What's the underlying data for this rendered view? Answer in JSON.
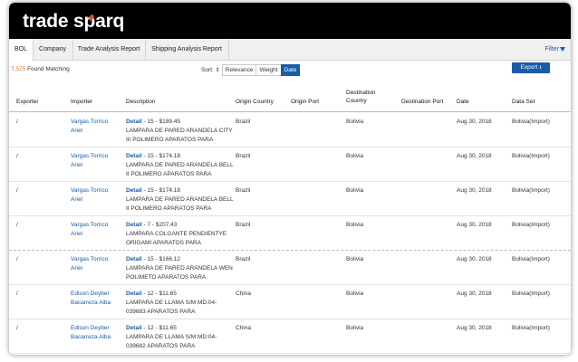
{
  "app": {
    "logo_text": "trade sparq"
  },
  "tabs": [
    {
      "label": "BOL"
    },
    {
      "label": "Company"
    },
    {
      "label": "Trade Analysis Report"
    },
    {
      "label": "Shipping Analysis Report"
    }
  ],
  "filter_label": "Filter",
  "results": {
    "count": "7,575",
    "suffix": " Found Matching"
  },
  "sort": {
    "label": "Sort:",
    "options": [
      "Relevance",
      "Weight",
      "Date"
    ],
    "selected": "Date"
  },
  "export_label": "Export",
  "columns": [
    "Exporter",
    "Importer",
    "Description",
    "Origin Country",
    "Origin Port",
    "Destination Country",
    "Destination Port",
    "Date",
    "Data Set"
  ],
  "rows": [
    {
      "exporter": "/",
      "importer": "Vargas Torrico Ariel",
      "detail": "Detail",
      "meta": " - 15 - $189.45",
      "desc": "LAMPARA DE PARED ARANDELA CITY III POLIMERO APARATOS PARA",
      "origin": "Brazil",
      "origin_port": "",
      "dest": "Bolivia",
      "dest_port": "",
      "date": "Aug 30, 2018",
      "dataset": "Bolivia(Import)"
    },
    {
      "exporter": "/",
      "importer": "Vargas Torrico Ariel",
      "detail": "Detail",
      "meta": " - 15 - $174.18",
      "desc": "LAMPARA DE PARED ARANDELA BELL II POLIMERO APARATOS PARA",
      "origin": "Brazil",
      "origin_port": "",
      "dest": "Bolivia",
      "dest_port": "",
      "date": "Aug 30, 2018",
      "dataset": "Bolivia(Import)"
    },
    {
      "exporter": "/",
      "importer": "Vargas Torrico Ariel",
      "detail": "Detail",
      "meta": " - 15 - $174.18",
      "desc": "LAMPARA DE PARED ARANDELA BELL II POLIMERO APARATOS PARA",
      "origin": "Brazil",
      "origin_port": "",
      "dest": "Bolivia",
      "dest_port": "",
      "date": "Aug 30, 2018",
      "dataset": "Bolivia(Import)"
    },
    {
      "exporter": "/",
      "importer": "Vargas Torrico Ariel",
      "detail": "Detail",
      "meta": " - 7 - $207.43",
      "desc": "LAMPARA COLGANTE PENDIENTYE ORIGAMI APARATOS PARA",
      "origin": "Brazil",
      "origin_port": "",
      "dest": "Bolivia",
      "dest_port": "",
      "date": "Aug 30, 2018",
      "dataset": "Bolivia(Import)"
    },
    {
      "exporter": "/",
      "importer": "Vargas Torrico Ariel",
      "detail": "Detail",
      "meta": " - 15 - $166.12",
      "desc": "LAMPARA DE PARED ARANDELA WEN POLIMETO APARATOS PARA",
      "origin": "Brazil",
      "origin_port": "",
      "dest": "Bolivia",
      "dest_port": "",
      "date": "Aug 30, 2018",
      "dataset": "Bolivia(Import)"
    },
    {
      "exporter": "/",
      "importer": "Edison Deyber Bacarreza Alba",
      "detail": "Detail",
      "meta": " - 12 - $11.65",
      "desc": "LAMPARA DE LLAMA S/M MD:04-039683 APARATOS PARA",
      "origin": "China",
      "origin_port": "",
      "dest": "Bolivia",
      "dest_port": "",
      "date": "Aug 30, 2018",
      "dataset": "Bolivia(Import)"
    },
    {
      "exporter": "/",
      "importer": "Edison Deyber Bacarreza Alba",
      "detail": "Detail",
      "meta": " - 12 - $11.65",
      "desc": "LAMPARA DE LLAMA S/M MD:04-039682 APARATOS PARA",
      "origin": "China",
      "origin_port": "",
      "dest": "Bolivia",
      "dest_port": "",
      "date": "Aug 30, 2018",
      "dataset": "Bolivia(Import)"
    }
  ]
}
